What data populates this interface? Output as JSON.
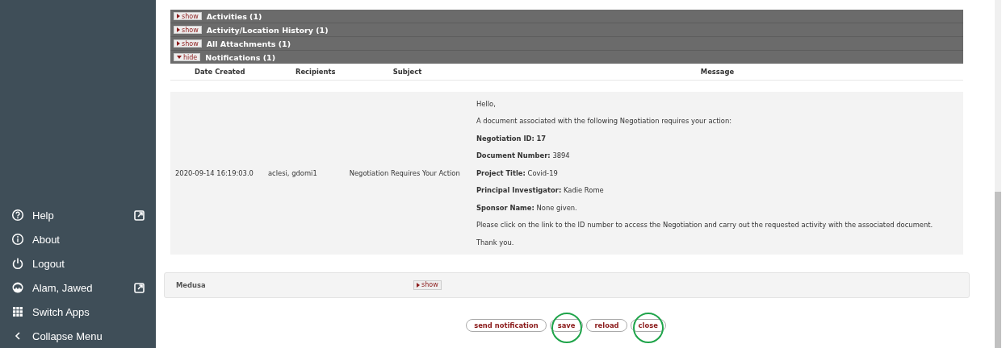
{
  "sidebar": {
    "items": [
      {
        "label": "Help",
        "external": true
      },
      {
        "label": "About",
        "external": false
      },
      {
        "label": "Logout",
        "external": false
      },
      {
        "label": "Alam, Jawed",
        "external": true
      },
      {
        "label": "Switch Apps",
        "external": false
      },
      {
        "label": "Collapse Menu",
        "external": false
      }
    ]
  },
  "sections": [
    {
      "toggle": "show",
      "title": "Activities (1)",
      "expanded": false
    },
    {
      "toggle": "show",
      "title": "Activity/Location History (1)",
      "expanded": false
    },
    {
      "toggle": "show",
      "title": "All Attachments (1)",
      "expanded": false
    },
    {
      "toggle": "hide",
      "title": "Notifications (1)",
      "expanded": true
    }
  ],
  "notifications": {
    "columns": [
      "Date Created",
      "Recipients",
      "Subject",
      "Message"
    ],
    "rows": [
      {
        "date": "2020-09-14 16:19:03.0",
        "recipients": "aclesi, gdomi1",
        "subject": "Negotiation Requires Your Action",
        "message": [
          {
            "text": "Hello,"
          },
          {
            "text": "A document associated with the following Negotiation requires your action:"
          },
          {
            "label": "Negotiation ID:",
            "link": "17"
          },
          {
            "label": "Document Number:",
            "text": "3894"
          },
          {
            "label": "Project Title:",
            "text": "Covid-19"
          },
          {
            "label": "Principal Investigator:",
            "text": "Kadie Rome"
          },
          {
            "label": "Sponsor Name:",
            "text": "None given."
          },
          {
            "text": "Please click on the link to the ID number to access the Negotiation and carry out the requested activity with the associated document."
          },
          {
            "text": "Thank you."
          }
        ]
      }
    ]
  },
  "medusa": {
    "title": "Medusa",
    "toggle": "show",
    "expanded": false
  },
  "buttons": [
    {
      "label": "send notification",
      "circled": false
    },
    {
      "label": "save",
      "circled": true
    },
    {
      "label": "reload",
      "circled": false
    },
    {
      "label": "close",
      "circled": true
    }
  ]
}
